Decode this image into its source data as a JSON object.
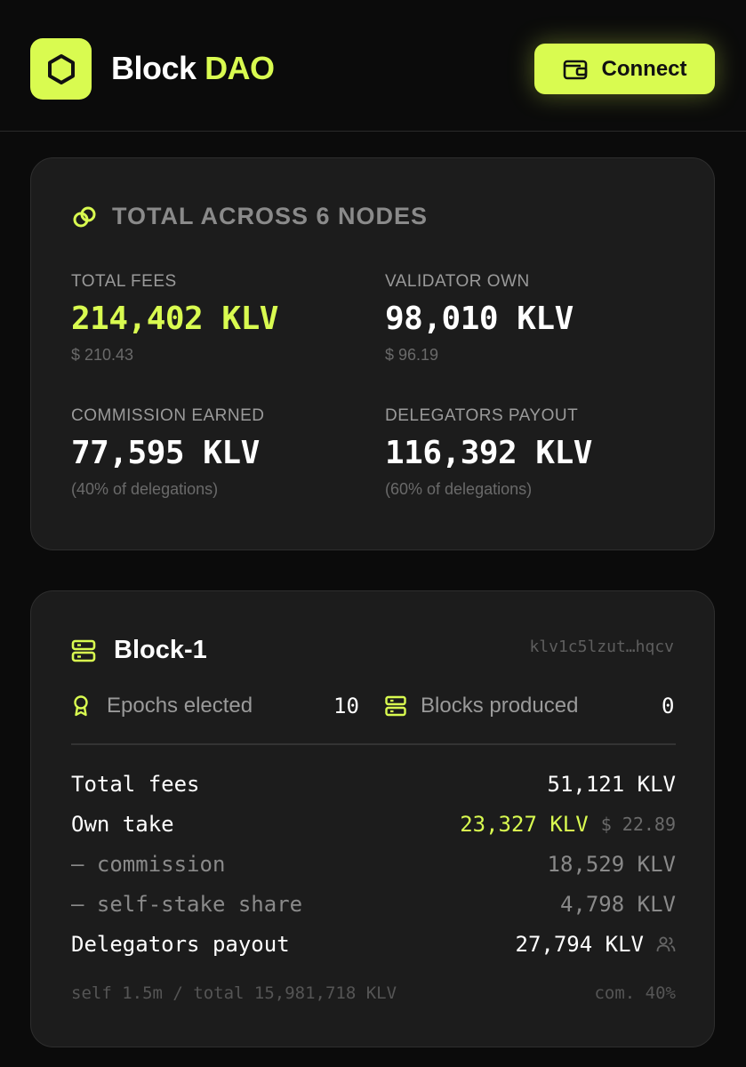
{
  "header": {
    "brand_primary": "Block",
    "brand_accent": "DAO",
    "connect_label": "Connect",
    "accent_color": "#d9fb50"
  },
  "totals": {
    "title": "TOTAL ACROSS 6 NODES",
    "icon": "link-icon",
    "stats": [
      {
        "label": "TOTAL FEES",
        "value": "214,402 KLV",
        "sub": "$ 210.43"
      },
      {
        "label": "VALIDATOR OWN",
        "value": "98,010 KLV",
        "sub": "$ 96.19"
      },
      {
        "label": "COMMISSION EARNED",
        "value": "77,595 KLV",
        "sub": "(40% of delegations)"
      },
      {
        "label": "DELEGATORS PAYOUT",
        "value": "116,392 KLV",
        "sub": "(60% of delegations)"
      }
    ]
  },
  "node": {
    "name": "Block-1",
    "address": "klv1c5lzut…hqcv",
    "epochs_label": "Epochs elected",
    "epochs_value": "10",
    "blocks_label": "Blocks produced",
    "blocks_value": "0",
    "rows": [
      {
        "label": "Total fees",
        "value": "51,121 KLV"
      },
      {
        "label": "Own take",
        "value": "23,327 KLV",
        "usd": "$ 22.89"
      },
      {
        "label": "— commission",
        "value": "18,529 KLV"
      },
      {
        "label": "— self-stake share",
        "value": "4,798 KLV"
      },
      {
        "label": "Delegators payout",
        "value": "27,794 KLV"
      }
    ],
    "footer_left": "self 1.5m / total 15,981,718 KLV",
    "footer_right": "com. 40%"
  }
}
